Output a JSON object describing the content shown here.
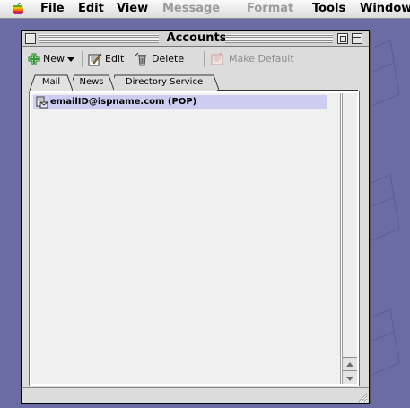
{
  "menubar": {
    "items": [
      {
        "label": "File",
        "enabled": true
      },
      {
        "label": "Edit",
        "enabled": true
      },
      {
        "label": "View",
        "enabled": true
      },
      {
        "label": "Message",
        "enabled": false
      },
      {
        "label": "Format",
        "enabled": false
      },
      {
        "label": "Tools",
        "enabled": true
      },
      {
        "label": "Window",
        "enabled": true
      }
    ]
  },
  "window": {
    "title": "Accounts"
  },
  "toolbar": {
    "new_label": "New",
    "edit_label": "Edit",
    "delete_label": "Delete",
    "make_default_label": "Make Default"
  },
  "tabs": [
    {
      "label": "Mail",
      "selected": true
    },
    {
      "label": "News",
      "selected": false
    },
    {
      "label": "Directory Service",
      "selected": false
    }
  ],
  "accounts": [
    {
      "label": "emailID@ispname.com (POP)",
      "selected": true,
      "icon": "mail-account-icon"
    }
  ],
  "colors": {
    "desktop": "#6c6ca4",
    "selection": "#cdcdf2",
    "new_icon": "#2e9d2e"
  }
}
